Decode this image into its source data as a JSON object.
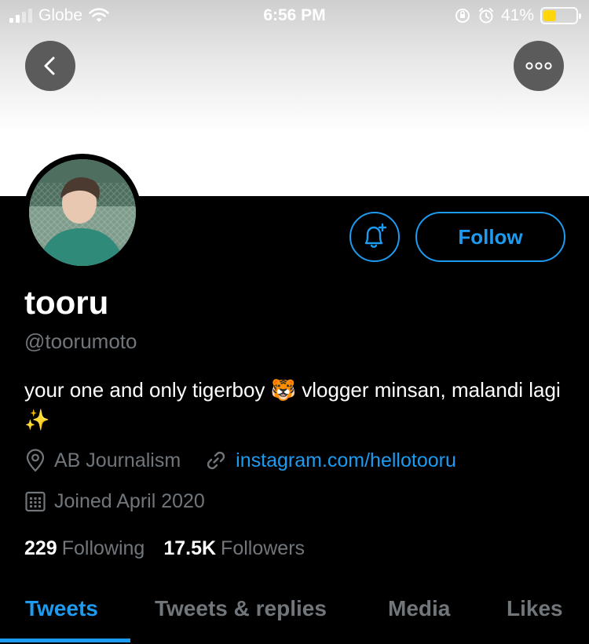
{
  "statusbar": {
    "carrier": "Globe",
    "time": "6:56 PM",
    "battery_text": "41%",
    "battery_level": 0.41
  },
  "profile": {
    "display_name": "tooru",
    "handle": "@toorumoto",
    "bio": "your one and only tigerboy 🐯 vlogger minsan, malandi lagi ✨",
    "location": "AB Journalism",
    "website": "instagram.com/hellotooru",
    "joined": "Joined April 2020",
    "following_count": "229",
    "following_label": "Following",
    "followers_count": "17.5K",
    "followers_label": "Followers"
  },
  "actions": {
    "follow_label": "Follow"
  },
  "tabs": [
    {
      "label": "Tweets",
      "active": true
    },
    {
      "label": "Tweets & replies",
      "active": false
    },
    {
      "label": "Media",
      "active": false
    },
    {
      "label": "Likes",
      "active": false
    }
  ],
  "colors": {
    "accent": "#1d9bf0",
    "muted": "#71767b",
    "background": "#000000"
  }
}
